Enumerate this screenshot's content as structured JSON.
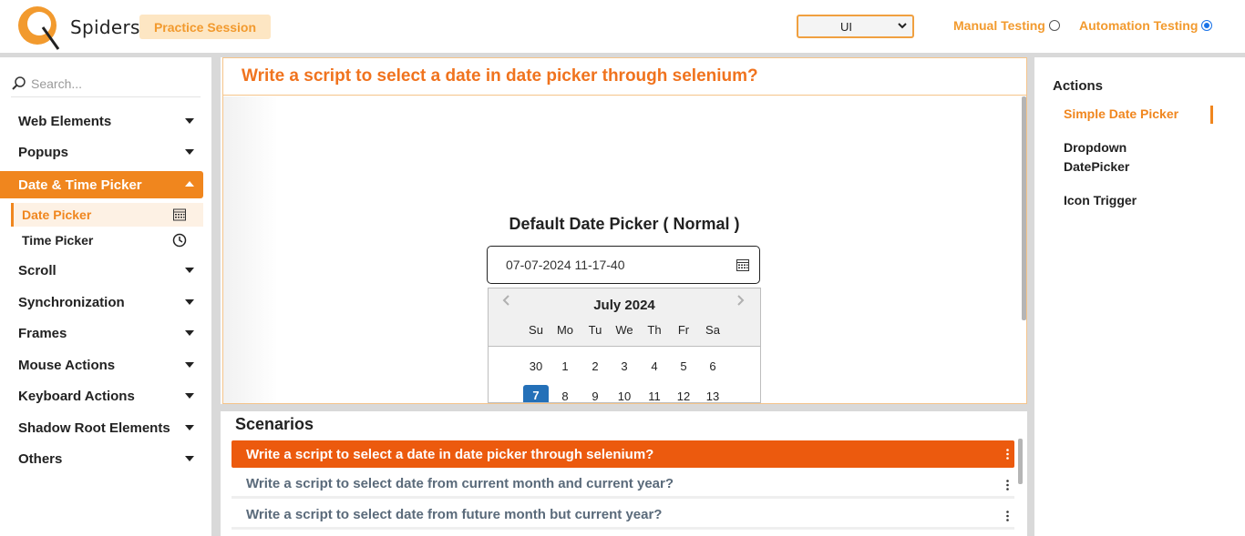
{
  "header": {
    "logo_text": "Spiders",
    "practice_label": "Practice Session",
    "mode_select_value": "UI",
    "radio_manual_label": "Manual Testing",
    "radio_automation_label": "Automation Testing",
    "selected_radio": "Automation Testing"
  },
  "sidebar": {
    "search_placeholder": "Search...",
    "items": [
      {
        "label": "Web Elements"
      },
      {
        "label": "Popups"
      },
      {
        "label": "Date & Time Picker"
      },
      {
        "label": "Scroll"
      },
      {
        "label": "Synchronization"
      },
      {
        "label": "Frames"
      },
      {
        "label": "Mouse Actions"
      },
      {
        "label": "Keyboard Actions"
      },
      {
        "label": "Shadow Root Elements"
      },
      {
        "label": "Others"
      }
    ],
    "sub_items": [
      {
        "label": "Date Picker",
        "icon": "calendar-grid-icon"
      },
      {
        "label": "Time Picker",
        "icon": "clock-icon"
      }
    ]
  },
  "question": {
    "title": "Write a script to select a date in date picker through selenium?",
    "picker_title": "Default Date Picker ( Normal )",
    "input_value": "07-07-2024  11-17-40",
    "calendar": {
      "month_label": "July 2024",
      "weekdays": [
        "Su",
        "Mo",
        "Tu",
        "We",
        "Th",
        "Fr",
        "Sa"
      ],
      "week1": [
        "30",
        "1",
        "2",
        "3",
        "4",
        "5",
        "6"
      ],
      "week2": [
        "7",
        "8",
        "9",
        "10",
        "11",
        "12",
        "13"
      ],
      "selected_day": "7"
    }
  },
  "scenarios": {
    "title": "Scenarios",
    "items": [
      {
        "label": "Write a script to select a date in date picker through selenium?"
      },
      {
        "label": "Write a script to select date from current month and current year?"
      },
      {
        "label": "Write a script to select date from future month but current year?"
      }
    ]
  },
  "actions": {
    "title": "Actions",
    "items": [
      {
        "label": "Simple Date Picker"
      },
      {
        "label": "Dropdown DatePicker"
      },
      {
        "label": "Icon Trigger"
      }
    ]
  },
  "colors": {
    "accent": "#f0861e",
    "active_scenario": "#ec5a0e",
    "selected_day": "#2470b8"
  }
}
